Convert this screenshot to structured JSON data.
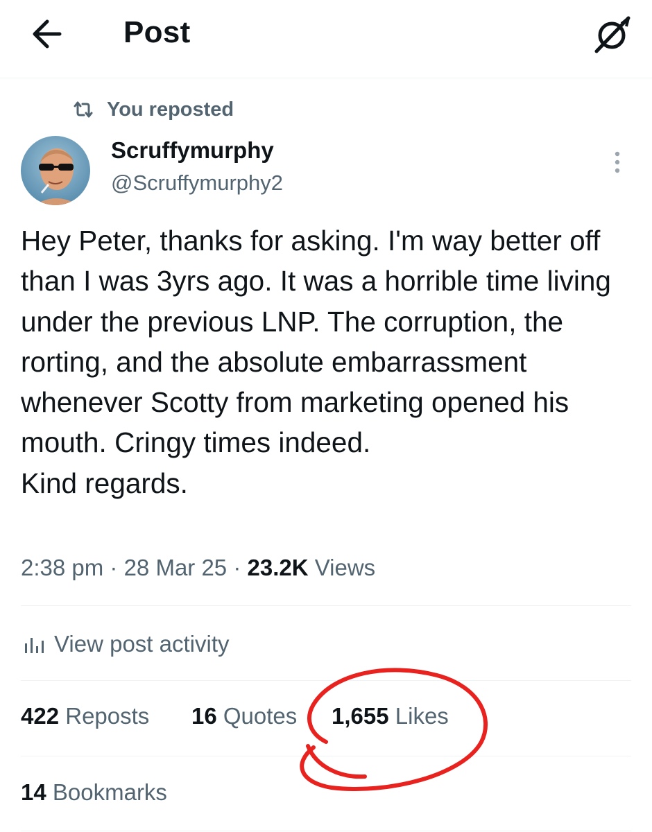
{
  "header": {
    "title": "Post",
    "back_icon": "arrow-left-icon",
    "grok_icon": "grok-icon"
  },
  "repost_context": {
    "icon": "repost-icon",
    "label": "You reposted"
  },
  "author": {
    "name": "Scruffymurphy",
    "handle": "@Scruffymurphy2"
  },
  "tweet": {
    "text": "Hey Peter, thanks for asking. I'm way better off than I was 3yrs ago. It was a horrible time living under the previous LNP. The corruption, the rorting, and the absolute embarrassment whenever Scotty from marketing opened his mouth. Cringy times indeed.\nKind regards."
  },
  "meta": {
    "time": "2:38 pm",
    "separator": " · ",
    "date": "28 Mar 25",
    "views_count": "23.2K",
    "views_label": " Views"
  },
  "activity": {
    "label": "View post activity"
  },
  "stats": {
    "reposts_count": "422",
    "reposts_label": " Reposts",
    "quotes_count": "16",
    "quotes_label": " Quotes",
    "likes_count": "1,655",
    "likes_label": " Likes",
    "bookmarks_count": "14",
    "bookmarks_label": " Bookmarks"
  },
  "colors": {
    "text_primary": "#0f1419",
    "text_secondary": "#536471",
    "divider": "#eff3f4",
    "annotation_red": "#e8231f"
  }
}
